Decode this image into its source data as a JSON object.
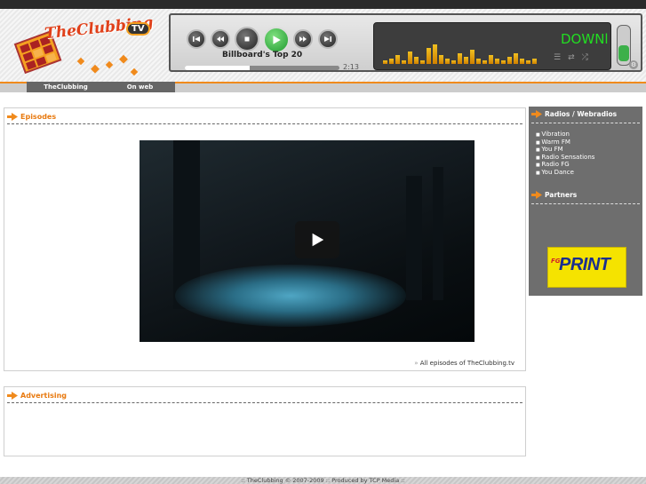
{
  "logo": {
    "text": "TheClubbing",
    "badge": "TV"
  },
  "player": {
    "track_title": "Billboard's Top 20",
    "time": "2:13",
    "progress": 0.42,
    "display_text": "DOWNl",
    "controls": [
      "previous-track-icon",
      "rewind-icon",
      "stop-icon",
      "play-icon",
      "fast-forward-icon",
      "next-track-icon"
    ]
  },
  "nav": {
    "tabs": [
      "TheClubbing",
      "On web"
    ]
  },
  "episodes": {
    "title": "Episodes",
    "all_episodes_link": "All episodes of TheClubbing.tv",
    "link_marker": "»"
  },
  "advertising": {
    "title": "Advertising"
  },
  "sidebar": {
    "radios_title": "Radios / Webradios",
    "radios": [
      "Vibration",
      "Warm FM",
      "You FM",
      "Radio Sensations",
      "Radio FG",
      "You Dance"
    ],
    "partners_title": "Partners",
    "partner_logo": {
      "text1": "FGL",
      "text2": "PRINT"
    }
  },
  "footer": {
    "text": ":: TheClubbing © 2007-2009 :: Produced by TCP Media ::"
  },
  "colors": {
    "accent": "#f08a1c",
    "sidebar": "#6e6e6e",
    "green": "#3cb04a"
  }
}
